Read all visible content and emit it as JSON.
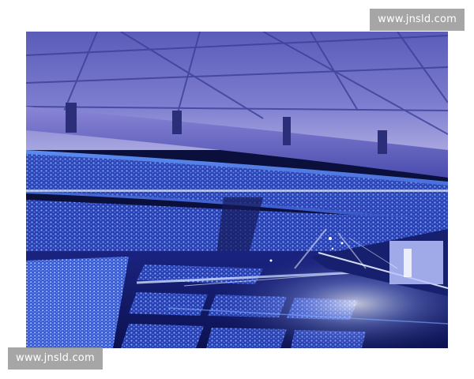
{
  "watermarks": {
    "top_right": "www.jnsld.com",
    "bottom_left": "www.jnsld.com"
  },
  "photo": {
    "subject": "stadium-concert",
    "palette": {
      "roof": "#6f6fc4",
      "roof_dark": "#3a3f9a",
      "light_sticks": "#4f86ff",
      "stage_glow": "#e8f0ff",
      "screen": "#b9c3ff",
      "night": "#0a1040"
    }
  }
}
